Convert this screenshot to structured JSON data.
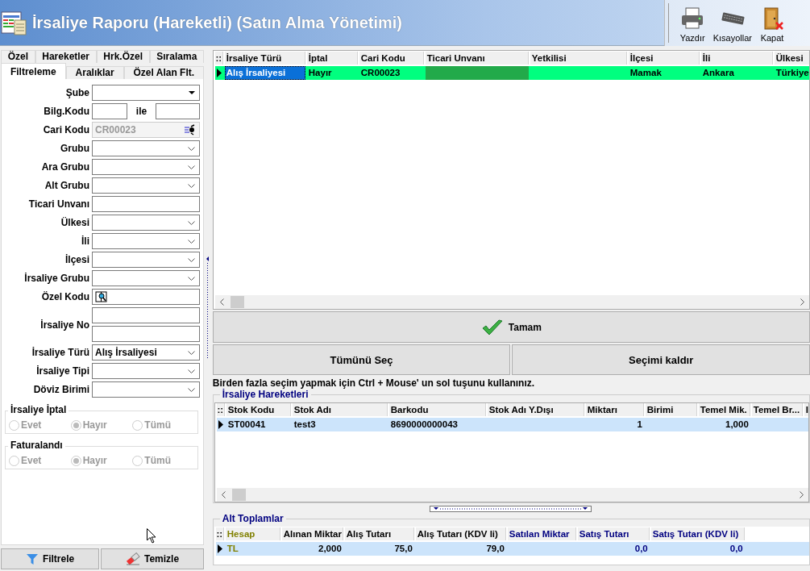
{
  "window": {
    "title": "İrsaliye Raporu (Hareketli) (Satın Alma Yönetimi)"
  },
  "toolbar": [
    {
      "kind": "print",
      "label": "Yazdır"
    },
    {
      "kind": "shortcuts",
      "label": "Kısayollar"
    },
    {
      "kind": "close",
      "label": "Kapat"
    }
  ],
  "tabs": [
    [
      {
        "label": "Özel",
        "selected": false
      },
      {
        "label": "Hareketler",
        "selected": false
      },
      {
        "label": "Hrk.Özel",
        "selected": false
      },
      {
        "label": "Sıralama",
        "selected": false
      }
    ],
    [
      {
        "label": "Filtreleme",
        "selected": true
      },
      {
        "label": "Aralıklar",
        "selected": false
      },
      {
        "label": "Özel Alan Flt.",
        "selected": false
      }
    ]
  ],
  "filters": [
    {
      "kind": "combo",
      "label": "Şube",
      "disabled": false
    },
    {
      "kind": "range",
      "label": "Bilg.Kodu",
      "between": "ile",
      "disabled": false
    },
    {
      "kind": "lookup",
      "label": "Cari Kodu",
      "value": "CR00023",
      "disabled": true
    },
    {
      "kind": "select",
      "label": "Grubu",
      "disabled": false
    },
    {
      "kind": "select",
      "label": "Ara Grubu",
      "disabled": false
    },
    {
      "kind": "select",
      "label": "Alt Grubu",
      "disabled": false
    },
    {
      "kind": "input",
      "label": "Ticari Unvanı",
      "disabled": false
    },
    {
      "kind": "select",
      "label": "Ülkesi",
      "disabled": false
    },
    {
      "kind": "select",
      "label": "İli",
      "disabled": false
    },
    {
      "kind": "select",
      "label": "İlçesi",
      "disabled": false
    },
    {
      "kind": "select",
      "label": "İrsaliye Grubu",
      "disabled": false
    },
    {
      "kind": "search",
      "label": "Özel Kodu",
      "disabled": false
    },
    {
      "kind": "double",
      "label": "İrsaliye No",
      "disabled": false
    },
    {
      "kind": "select",
      "label": "İrsaliye Türü",
      "value": "Alış İrsaliyesi",
      "disabled": false
    },
    {
      "kind": "select",
      "label": "İrsaliye Tipi",
      "disabled": false
    },
    {
      "kind": "select",
      "label": "Döviz Birimi",
      "disabled": false
    }
  ],
  "radio_groups": [
    {
      "title": "İrsaliye İptal",
      "disabled": true,
      "options": [
        {
          "label": "Evet",
          "selected": false
        },
        {
          "label": "Hayır",
          "selected": true
        },
        {
          "label": "Tümü",
          "selected": false
        }
      ]
    },
    {
      "title": "Faturalandı",
      "disabled": true,
      "options": [
        {
          "label": "Evet",
          "selected": false
        },
        {
          "label": "Hayır",
          "selected": true
        },
        {
          "label": "Tümü",
          "selected": false
        }
      ]
    }
  ],
  "filter_buttons": [
    {
      "kind": "filter",
      "label": "Filtrele"
    },
    {
      "kind": "clear",
      "label": "Temizle"
    }
  ],
  "results": {
    "marker": "::",
    "columns": [
      {
        "label": "İrsaliye Türü"
      },
      {
        "label": "İptal"
      },
      {
        "label": "Cari Kodu"
      },
      {
        "label": "Ticari Unvanı"
      },
      {
        "label": "Yetkilisi"
      },
      {
        "label": "İlçesi"
      },
      {
        "label": "İli"
      },
      {
        "label": "Ülkesi"
      }
    ],
    "rows": [
      {
        "selected": true,
        "cells": [
          {
            "text": "Alış İrsaliyesi",
            "focused": true,
            "highlighted": false
          },
          {
            "text": "Hayır",
            "focused": false,
            "highlighted": false
          },
          {
            "text": "CR00023",
            "focused": false,
            "highlighted": false
          },
          {
            "focused": false,
            "highlighted": true
          },
          {
            "focused": false,
            "highlighted": false
          },
          {
            "text": "Mamak",
            "focused": false,
            "highlighted": false
          },
          {
            "text": "Ankara",
            "focused": false,
            "highlighted": false
          },
          {
            "text": "Türkiye",
            "focused": false,
            "highlighted": false
          }
        ]
      }
    ]
  },
  "ok_button": {
    "label": "Tamam"
  },
  "selection_buttons": [
    {
      "label": "Tümünü Seç"
    },
    {
      "label": "Seçimi kaldır"
    }
  ],
  "hint": "Birden fazla seçim yapmak için Ctrl + Mouse' un sol tuşunu kullanınız.",
  "movements": {
    "title": "İrsaliye Hareketleri",
    "marker": "::",
    "columns": [
      {
        "label": "Stok Kodu"
      },
      {
        "label": "Stok Adı"
      },
      {
        "label": "Barkodu"
      },
      {
        "label": "Stok Adı Y.Dışı"
      },
      {
        "label": "Miktarı",
        "kind": "number"
      },
      {
        "label": "Birimi"
      },
      {
        "label": "Temel Mik.",
        "kind": "number"
      },
      {
        "label": "Temel Br..."
      },
      {
        "label": "I"
      }
    ],
    "rows": [
      {
        "selected": true,
        "cells": [
          {
            "text": "ST00041"
          },
          {
            "text": "test3"
          },
          {
            "text": "8690000000043"
          },
          {},
          {
            "text": "1"
          },
          {},
          {
            "text": "1,000"
          },
          {},
          {}
        ]
      }
    ]
  },
  "subtotals": {
    "title": "Alt Toplamlar",
    "marker": "::",
    "columns": [
      {
        "label": "Hesap",
        "color": "#808000"
      },
      {
        "label": "Alınan Miktar",
        "color": "#000000",
        "kind": "number"
      },
      {
        "label": "Alış Tutarı",
        "color": "#000000",
        "kind": "number"
      },
      {
        "label": "Alış Tutarı (KDV li)",
        "color": "#000000",
        "kind": "number"
      },
      {
        "label": "Satılan Miktar",
        "color": "#000080",
        "kind": "number"
      },
      {
        "label": "Satış Tutarı",
        "color": "#000080",
        "kind": "number"
      },
      {
        "label": "Satış Tutarı (KDV li)",
        "color": "#000080",
        "kind": "number"
      }
    ],
    "rows": [
      {
        "selected": true,
        "cells": [
          {
            "text": "TL"
          },
          {
            "text": "2,000"
          },
          {
            "text": "75,0"
          },
          {
            "text": "79,0"
          },
          {},
          {
            "text": "0,0"
          },
          {
            "text": "0,0"
          }
        ]
      }
    ]
  }
}
